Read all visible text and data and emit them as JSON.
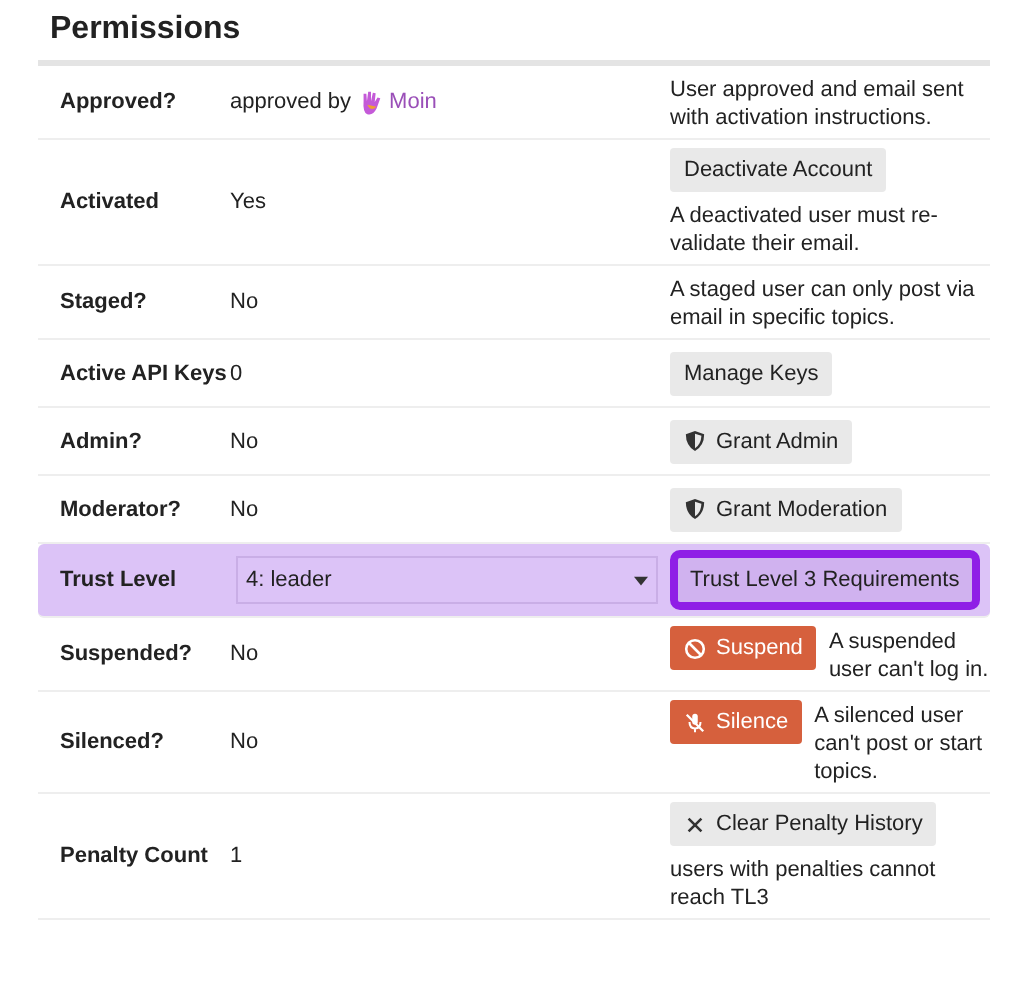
{
  "title": "Permissions",
  "rows": [
    {
      "label": "Approved?",
      "value": {
        "kind": "user",
        "prefix": "approved by",
        "user": "Moin"
      },
      "description": "User approved and email sent with activation instructions.",
      "highlighted": false
    },
    {
      "label": "Activated",
      "value": {
        "kind": "text",
        "text": "Yes"
      },
      "action": {
        "label": "Deactivate Account",
        "kind": "plain"
      },
      "description": "A deactivated user must re-validate their email.",
      "highlighted": false
    },
    {
      "label": "Staged?",
      "value": {
        "kind": "text",
        "text": "No"
      },
      "description": "A staged user can only post via email in specific topics.",
      "highlighted": false
    },
    {
      "label": "Active API Keys",
      "value": {
        "kind": "text",
        "text": "0"
      },
      "action": {
        "label": "Manage Keys",
        "kind": "plain"
      },
      "highlighted": false
    },
    {
      "label": "Admin?",
      "value": {
        "kind": "text",
        "text": "No"
      },
      "action": {
        "label": "Grant Admin",
        "kind": "grant"
      },
      "highlighted": false
    },
    {
      "label": "Moderator?",
      "value": {
        "kind": "text",
        "text": "No"
      },
      "action": {
        "label": "Grant Moderation",
        "kind": "grant"
      },
      "highlighted": false
    },
    {
      "label": "Trust Level",
      "value": {
        "kind": "select",
        "text": "4: leader"
      },
      "action": {
        "label": "Trust Level 3 Requirements",
        "kind": "plain"
      },
      "highlighted": true
    },
    {
      "label": "Suspended?",
      "value": {
        "kind": "text",
        "text": "No"
      },
      "action": {
        "label": "Suspend",
        "kind": "suspend"
      },
      "description": "A suspended user can't log in.",
      "highlighted": false
    },
    {
      "label": "Silenced?",
      "value": {
        "kind": "text",
        "text": "No"
      },
      "action": {
        "label": "Silence",
        "kind": "silence"
      },
      "description": "A silenced user can't post or start topics.",
      "highlighted": false
    },
    {
      "label": "Penalty Count",
      "value": {
        "kind": "text",
        "text": "1"
      },
      "action": {
        "label": "Clear Penalty History",
        "kind": "clear"
      },
      "description": "users with penalties cannot reach TL3",
      "highlighted": false
    }
  ]
}
